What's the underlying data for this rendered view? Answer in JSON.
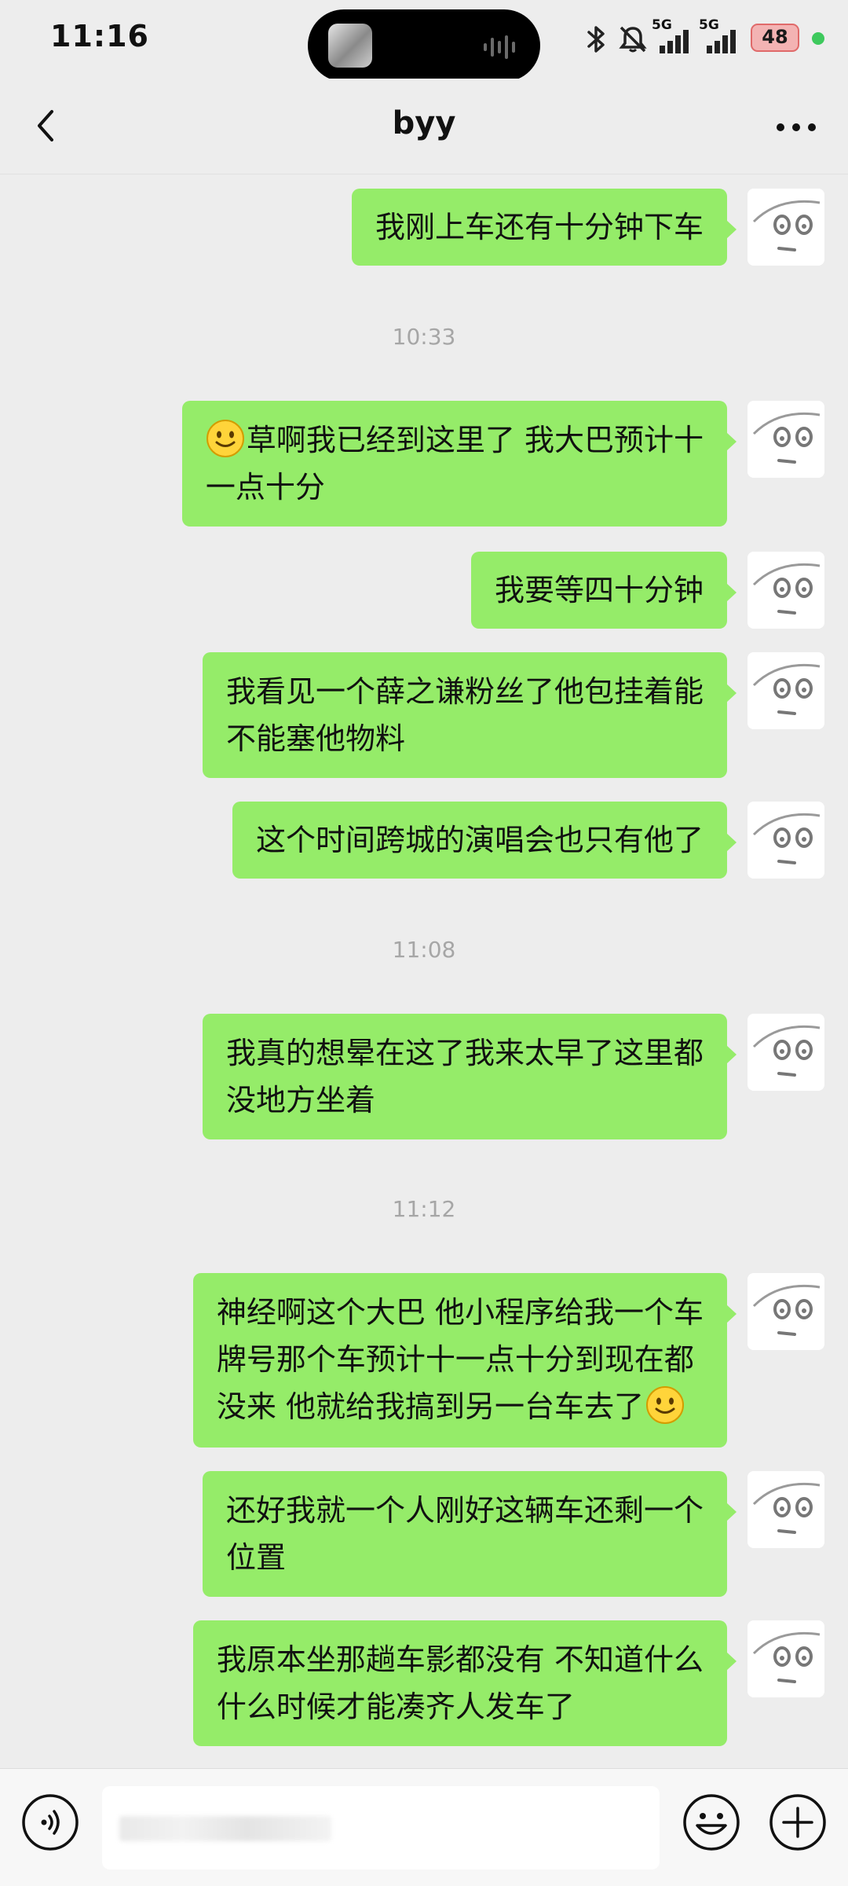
{
  "status_bar": {
    "time": "11:16",
    "battery": "48",
    "network1": "5G",
    "network2": "5G"
  },
  "nav": {
    "title": "byy"
  },
  "messages": [
    {
      "text": "我刚上车还有十分钟下车"
    },
    {
      "text": "草啊我已经到这里了 我大巴预计十",
      "text2": "一点十分",
      "leading_emoji": "smile-emoji"
    },
    {
      "text": "我要等四十分钟"
    },
    {
      "text": "我看见一个薛之谦粉丝了他包挂着能",
      "text2": "不能塞他物料"
    },
    {
      "text": "这个时间跨城的演唱会也只有他了"
    },
    {
      "text": "我真的想晕在这了我来太早了这里都",
      "text2": "没地方坐着"
    },
    {
      "text": "神经啊这个大巴 他小程序给我一个车",
      "text2": "牌号那个车预计十一点十分到现在都",
      "text3": "没来 他就给我搞到另一台车去了",
      "trailing_emoji": "smile-emoji"
    },
    {
      "text": "还好我就一个人刚好这辆车还剩一个",
      "text2": "位置"
    },
    {
      "text": "我原本坐那趟车影都没有 不知道什么",
      "text2": "什么时候才能凑齐人发车了"
    }
  ],
  "timestamps": [
    "10:33",
    "11:08",
    "11:12"
  ],
  "input": {
    "placeholder": ""
  },
  "colors": {
    "background": "#ededed",
    "bubble": "#95ec69",
    "timestamp": "#a6a6a6",
    "input_bar": "#f7f7f7"
  }
}
